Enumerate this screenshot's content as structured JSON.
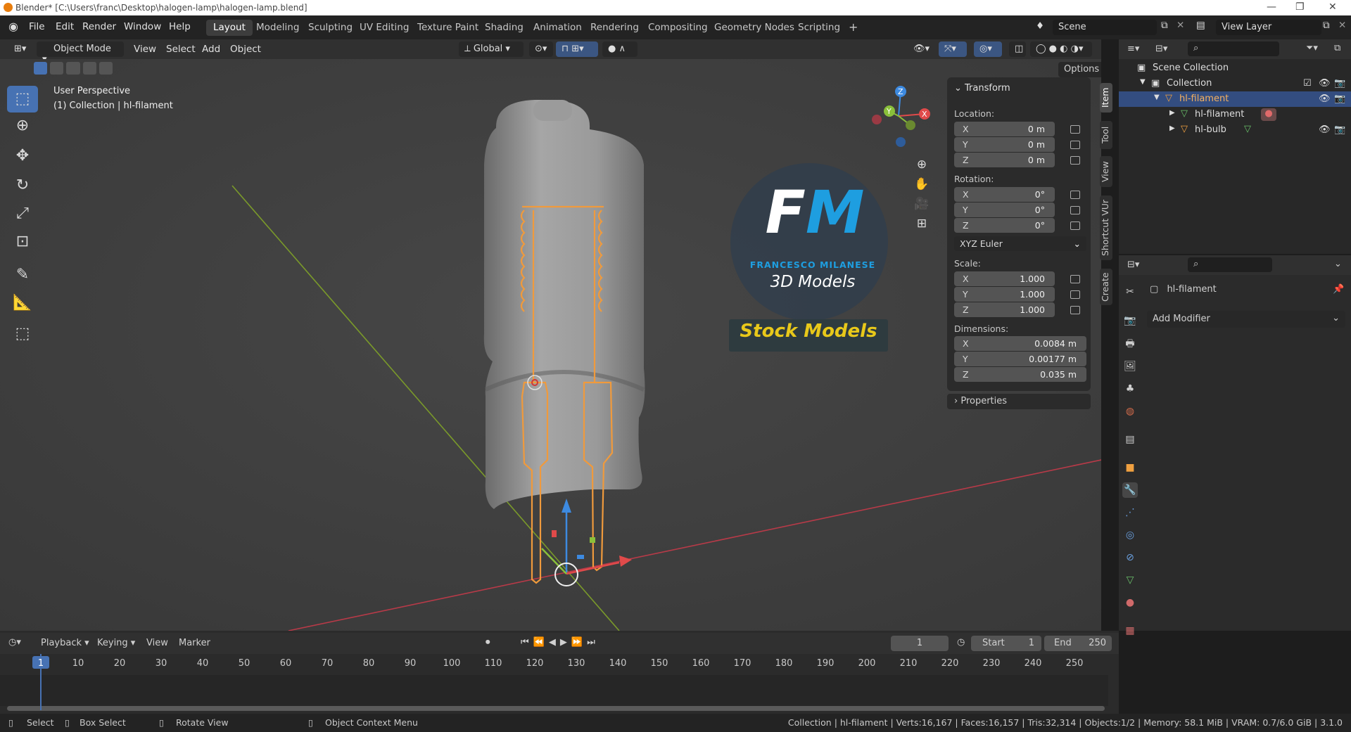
{
  "window": {
    "title": "Blender* [C:\\Users\\franc\\Desktop\\halogen-lamp\\halogen-lamp.blend]",
    "minimize": "—",
    "maximize": "❐",
    "close": "✕"
  },
  "menubar": {
    "file": "File",
    "edit": "Edit",
    "render": "Render",
    "window": "Window",
    "help": "Help"
  },
  "workspaces": [
    "Layout",
    "Modeling",
    "Sculpting",
    "UV Editing",
    "Texture Paint",
    "Shading",
    "Animation",
    "Rendering",
    "Compositing",
    "Geometry Nodes",
    "Scripting"
  ],
  "add_workspace": "+",
  "scene": {
    "label": "Scene",
    "view_layer": "View Layer"
  },
  "viewport_header": {
    "mode": "Object Mode",
    "view": "View",
    "select": "Select",
    "add": "Add",
    "object": "Object",
    "orientation": "Global",
    "options": "Options"
  },
  "viewport": {
    "perspective": "User Perspective",
    "collection_info": "(1) Collection | hl-filament",
    "watermark": {
      "initials": "FM",
      "name": "FRANCESCO MILANESE",
      "subtitle": "3D Models",
      "stock": "Stock Models"
    },
    "gizmo": {
      "z": "Z",
      "y": "Y",
      "x": "X"
    }
  },
  "npanel": {
    "transform": "Transform",
    "location_label": "Location:",
    "location": [
      {
        "axis": "X",
        "value": "0 m"
      },
      {
        "axis": "Y",
        "value": "0 m"
      },
      {
        "axis": "Z",
        "value": "0 m"
      }
    ],
    "rotation_label": "Rotation:",
    "rotation": [
      {
        "axis": "X",
        "value": "0°"
      },
      {
        "axis": "Y",
        "value": "0°"
      },
      {
        "axis": "Z",
        "value": "0°"
      }
    ],
    "rotation_mode": "XYZ Euler",
    "scale_label": "Scale:",
    "scale": [
      {
        "axis": "X",
        "value": "1.000"
      },
      {
        "axis": "Y",
        "value": "1.000"
      },
      {
        "axis": "Z",
        "value": "1.000"
      }
    ],
    "dimensions_label": "Dimensions:",
    "dimensions": [
      {
        "axis": "X",
        "value": "0.0084 m"
      },
      {
        "axis": "Y",
        "value": "0.00177 m"
      },
      {
        "axis": "Z",
        "value": "0.035 m"
      }
    ],
    "properties": "Properties",
    "tabs": [
      "Item",
      "Tool",
      "View",
      "Shortcut VUr",
      "Create"
    ]
  },
  "outliner": {
    "scene_collection": "Scene Collection",
    "collection": "Collection",
    "items": [
      {
        "name": "hl-filament"
      },
      {
        "name": "hl-filament"
      },
      {
        "name": "hl-bulb"
      }
    ]
  },
  "properties": {
    "object_name": "hl-filament",
    "add_modifier": "Add Modifier"
  },
  "timeline": {
    "playback": "Playback",
    "keying": "Keying",
    "view": "View",
    "marker": "Marker",
    "current_frame": "1",
    "start_label": "Start",
    "start": "1",
    "end_label": "End",
    "end": "250",
    "ticks": [
      "1",
      "10",
      "20",
      "30",
      "40",
      "50",
      "60",
      "70",
      "80",
      "90",
      "100",
      "110",
      "120",
      "130",
      "140",
      "150",
      "160",
      "170",
      "180",
      "190",
      "200",
      "210",
      "220",
      "230",
      "240",
      "250"
    ]
  },
  "statusbar": {
    "select": "Select",
    "box_select": "Box Select",
    "rotate": "Rotate View",
    "context": "Object Context Menu",
    "stats": "Collection | hl-filament | Verts:16,167 | Faces:16,157 | Tris:32,314 | Objects:1/2 | Memory: 58.1 MiB | VRAM: 0.7/6.0 GiB | 3.1.0"
  }
}
